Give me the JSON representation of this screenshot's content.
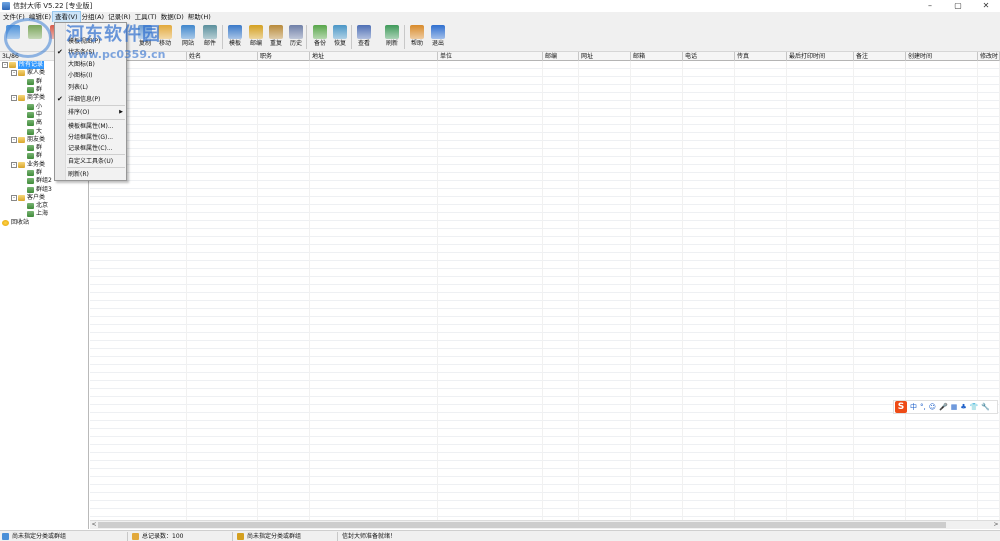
{
  "window": {
    "title": "信封大师 V5.22 [专业版]",
    "controls": [
      "–",
      "▢",
      "✕"
    ]
  },
  "watermark": {
    "text": "河东软件园",
    "url": "www.pc0359.cn"
  },
  "menubar": {
    "items": [
      {
        "label": "文件(F)"
      },
      {
        "label": "编辑(E)"
      },
      {
        "label": "查看(V)"
      },
      {
        "label": "分组(A)"
      },
      {
        "label": "记录(R)"
      },
      {
        "label": "工具(T)"
      },
      {
        "label": "数据(D)"
      },
      {
        "label": "帮助(H)"
      }
    ]
  },
  "toolbar": {
    "buttons": [
      {
        "label": "",
        "icon": "new-icon",
        "color": "#4a8fd8"
      },
      {
        "label": "",
        "icon": "edit-icon",
        "color": "#7aa55a"
      },
      {
        "label": "",
        "icon": "delete-icon",
        "color": "#d85a4a"
      },
      {
        "label": "",
        "icon": "cut-icon",
        "color": "#8a8a8a"
      },
      {
        "label": "",
        "icon": "paste-icon",
        "color": "#c59a3a"
      },
      {
        "label": "复制",
        "icon": "copy-icon",
        "color": "#6a9bd1"
      },
      {
        "label": "移动",
        "icon": "move-icon",
        "color": "#e2a93b"
      },
      {
        "label": "网站",
        "icon": "globe-icon",
        "color": "#3f86cc"
      },
      {
        "label": "邮件",
        "icon": "mail-icon",
        "color": "#5a8f9c"
      },
      {
        "label": "模板",
        "icon": "template-icon",
        "color": "#3a79c8"
      },
      {
        "label": "邮编",
        "icon": "postcode-icon",
        "color": "#d4a020"
      },
      {
        "label": "重复",
        "icon": "duplicate-icon",
        "color": "#b88a3a"
      },
      {
        "label": "历史",
        "icon": "history-icon",
        "color": "#6f7fa8"
      },
      {
        "label": "备份",
        "icon": "backup-icon",
        "color": "#58a64a"
      },
      {
        "label": "恢复",
        "icon": "restore-icon",
        "color": "#4a96c6"
      },
      {
        "label": "查看",
        "icon": "view-icon",
        "color": "#4f6fb5"
      },
      {
        "label": "刷新",
        "icon": "refresh-icon",
        "color": "#3f9a5a"
      },
      {
        "label": "帮助",
        "icon": "help-icon",
        "color": "#d88a2a"
      },
      {
        "label": "退出",
        "icon": "power-icon",
        "color": "#2f6fcf"
      }
    ]
  },
  "tree": {
    "header": "3L/86",
    "rows": [
      {
        "label": "所有记录",
        "icon": "root",
        "level": 0,
        "expander": "⊟",
        "selected": true
      },
      {
        "label": "家人类",
        "icon": "folder",
        "level": 1,
        "expander": "⊟"
      },
      {
        "label": "群",
        "icon": "book",
        "level": 2,
        "expander": ""
      },
      {
        "label": "群",
        "icon": "book",
        "level": 2,
        "expander": ""
      },
      {
        "label": "商学类",
        "icon": "folder",
        "level": 1,
        "expander": "⊟"
      },
      {
        "label": "小",
        "icon": "book",
        "level": 2,
        "expander": ""
      },
      {
        "label": "中",
        "icon": "book",
        "level": 2,
        "expander": ""
      },
      {
        "label": "高",
        "icon": "book",
        "level": 2,
        "expander": ""
      },
      {
        "label": "大",
        "icon": "book",
        "level": 2,
        "expander": ""
      },
      {
        "label": "朋友类",
        "icon": "folder",
        "level": 1,
        "expander": "⊟"
      },
      {
        "label": "群",
        "icon": "book",
        "level": 2,
        "expander": ""
      },
      {
        "label": "群",
        "icon": "book",
        "level": 2,
        "expander": ""
      },
      {
        "label": "业务类",
        "icon": "folder",
        "level": 1,
        "expander": "⊟"
      },
      {
        "label": "群",
        "icon": "book",
        "level": 2,
        "expander": ""
      },
      {
        "label": "群组2",
        "icon": "book",
        "level": 2,
        "expander": ""
      },
      {
        "label": "群组3",
        "icon": "book",
        "level": 2,
        "expander": ""
      },
      {
        "label": "客户类",
        "icon": "folder",
        "level": 1,
        "expander": "⊟"
      },
      {
        "label": "北京",
        "icon": "book",
        "level": 2,
        "expander": ""
      },
      {
        "label": "上海",
        "icon": "book",
        "level": 2,
        "expander": ""
      },
      {
        "label": "回收站",
        "icon": "bin",
        "level": 0,
        "expander": ""
      }
    ]
  },
  "grid": {
    "columns": [
      {
        "label": "称呼"
      },
      {
        "label": "姓名"
      },
      {
        "label": "职务"
      },
      {
        "label": "地址"
      },
      {
        "label": "单位"
      },
      {
        "label": "邮编"
      },
      {
        "label": "网址"
      },
      {
        "label": "邮箱"
      },
      {
        "label": "电话"
      },
      {
        "label": "传真"
      },
      {
        "label": "最后打印时间"
      },
      {
        "label": "备注"
      },
      {
        "label": "创建时间"
      },
      {
        "label": "修改时"
      }
    ]
  },
  "view_menu": {
    "items": [
      {
        "label": "模板视图(P)",
        "checked": false,
        "submenu": false
      },
      {
        "label": "状态条(S)",
        "checked": true,
        "submenu": false
      },
      {
        "label": "大图标(B)",
        "checked": false,
        "submenu": false
      },
      {
        "label": "小图标(I)",
        "checked": false,
        "submenu": false
      },
      {
        "label": "列表(L)",
        "checked": false,
        "submenu": false
      },
      {
        "label": "详细信息(P)",
        "checked": true,
        "submenu": false
      },
      {
        "label": "排序(O)",
        "checked": false,
        "submenu": true
      },
      {
        "label": "模板框属性(M)...",
        "checked": false,
        "submenu": false
      },
      {
        "label": "分组框属性(G)...",
        "checked": false,
        "submenu": false
      },
      {
        "label": "记录框属性(C)...",
        "checked": false,
        "submenu": false
      },
      {
        "label": "自定义工具条(U)",
        "checked": false,
        "submenu": false
      },
      {
        "label": "刷新(R)",
        "checked": false,
        "submenu": false
      }
    ]
  },
  "statusbar": {
    "group_status": "尚未指定分类或群组",
    "record_count": "总记录数：100",
    "group_status2": "尚未指定分类或群组",
    "ready": "信封大师准备就绪！"
  },
  "ime": {
    "logo": "S",
    "items": [
      "中",
      "°,",
      "☺",
      "🎤",
      "▦",
      "♣",
      "👕",
      "🔧"
    ]
  },
  "scrollbar": {
    "left_arrow": "<",
    "right_arrow": ">"
  },
  "colors": {
    "selection": "#3399ff",
    "menu_highlight": "#cce4f7",
    "ime_logo": "#ee4b16"
  }
}
